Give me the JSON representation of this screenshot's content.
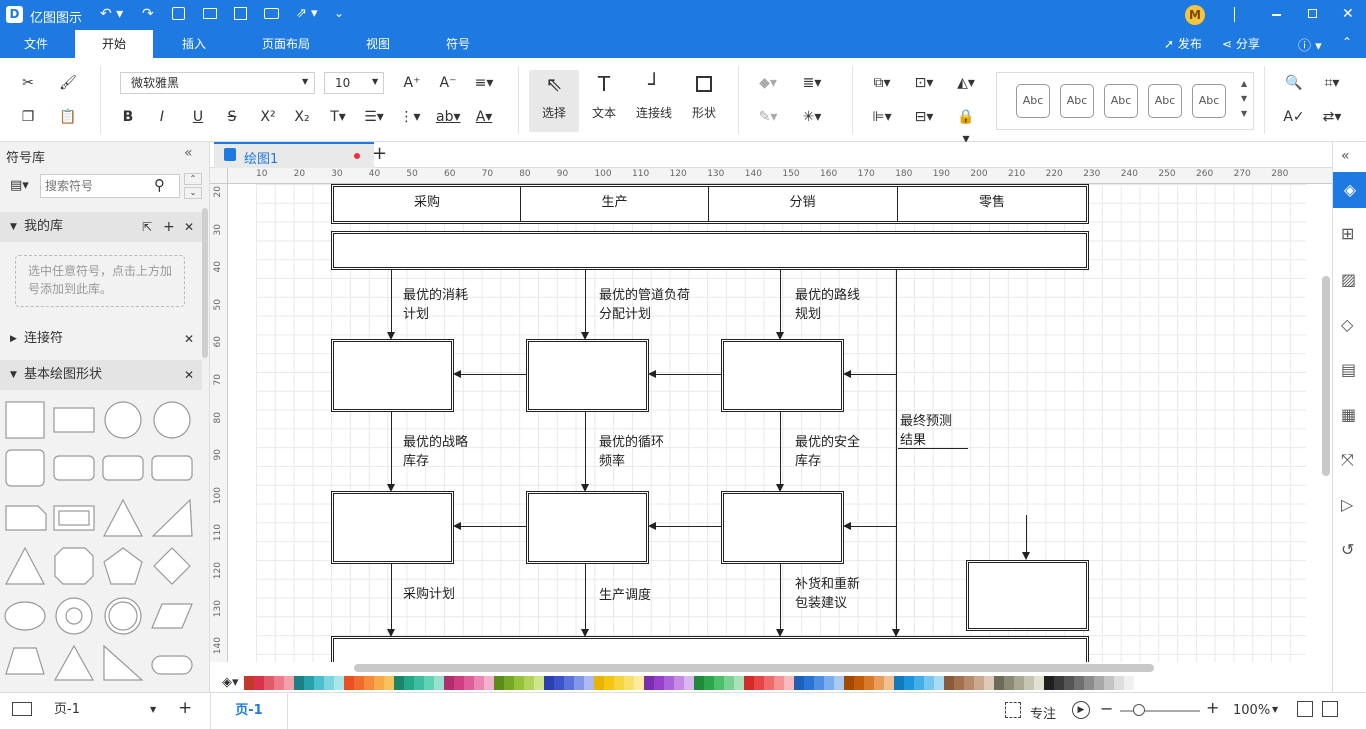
{
  "app": {
    "name": "亿图图示"
  },
  "tabs": [
    "文件",
    "开始",
    "插入",
    "页面布局",
    "视图",
    "符号"
  ],
  "title_right": {
    "publish": "发布",
    "share": "分享",
    "avatar": "M"
  },
  "ribbon": {
    "font": "微软雅黑",
    "size": "10",
    "tools": {
      "select": "选择",
      "text": "文本",
      "connector": "连接线",
      "shape": "形状"
    },
    "styles": [
      "Abc",
      "Abc",
      "Abc",
      "Abc",
      "Abc"
    ]
  },
  "left_panel": {
    "title": "符号库",
    "search_placeholder": "搜索符号",
    "my_lib": "我的库",
    "my_lib_hint": "选中任意符号，点击上方加号添加到此库。",
    "connectors": "连接符",
    "basic_shapes": "基本绘图形状"
  },
  "doc_tab": "绘图1",
  "ruler_h": [
    "10",
    "20",
    "30",
    "40",
    "50",
    "60",
    "70",
    "80",
    "90",
    "100",
    "110",
    "120",
    "130",
    "140",
    "150",
    "160",
    "170",
    "180",
    "190",
    "200",
    "210",
    "220",
    "230",
    "240",
    "250",
    "260",
    "270",
    "280"
  ],
  "ruler_v": [
    "20",
    "30",
    "40",
    "50",
    "60",
    "70",
    "80",
    "90",
    "100",
    "110",
    "120",
    "130",
    "140"
  ],
  "diagram": {
    "headers": [
      "采购",
      "生产",
      "分销",
      "零售"
    ],
    "labels": {
      "l1": "最优的消耗\n计划",
      "l2": "最优的管道负荷\n分配计划",
      "l3": "最优的路线\n规划",
      "l4": "最终预测\n结果",
      "l5": "最优的战略\n库存",
      "l6": "最优的循环\n频率",
      "l7": "最优的安全\n库存",
      "l8": "采购计划",
      "l9": "生产调度",
      "l10": "补货和重新\n包装建议"
    }
  },
  "status": {
    "page_select": "页-1",
    "page_tab": "页-1",
    "focus": "专注",
    "zoom": "100%"
  },
  "colors": {
    "accent": "#1e7ae0"
  },
  "palette": [
    "#c0392b",
    "#d8324c",
    "#e05a6a",
    "#ee7b8a",
    "#f2a0aa",
    "#1b7f8a",
    "#27a0ad",
    "#4cc0cc",
    "#7dd6dd",
    "#a8e6ea",
    "#e8511f",
    "#f26b2e",
    "#f58a3a",
    "#f8a94a",
    "#fbc25c",
    "#17866a",
    "#23a889",
    "#3cbfa0",
    "#62d2b6",
    "#96e2cf",
    "#b02e6d",
    "#cf3d82",
    "#e05d9a",
    "#eb87b5",
    "#f3b0cf",
    "#5c8a1b",
    "#77a824",
    "#94c23a",
    "#b2d45c",
    "#cfe58a",
    "#2b3fb0",
    "#3b54cc",
    "#5a72de",
    "#8397ea",
    "#aebbf3",
    "#e8b400",
    "#f3c612",
    "#f7d43c",
    "#f9e06c",
    "#fcec9e",
    "#7b2fb0",
    "#9640cc",
    "#ac63da",
    "#c48ce6",
    "#dbb7f1",
    "#1f8a3a",
    "#2ba64d",
    "#4cbf6b",
    "#7ad192",
    "#a8e2b6",
    "#d32a2a",
    "#e84545",
    "#ef6a6a",
    "#f49292",
    "#f8baba",
    "#1e5fb8",
    "#2a74d6",
    "#4d8fe3",
    "#7aaded",
    "#a8caf4",
    "#a34a00",
    "#c25c0a",
    "#d97a2a",
    "#e89d5a",
    "#f3c090",
    "#0e7bbf",
    "#1d95dc",
    "#45aee8",
    "#76c6ef",
    "#a8dcf5",
    "#8a5a3c",
    "#a3704f",
    "#b88a6c",
    "#cca88f",
    "#e0c8b6",
    "#6b6b5a",
    "#8a8a74",
    "#a8a892",
    "#c6c6b2",
    "#e2e2d2",
    "#202020",
    "#3a3a3a",
    "#555555",
    "#707070",
    "#8c8c8c",
    "#a8a8a8",
    "#c4c4c4",
    "#dedede",
    "#f0f0f0",
    "#ffffff"
  ]
}
